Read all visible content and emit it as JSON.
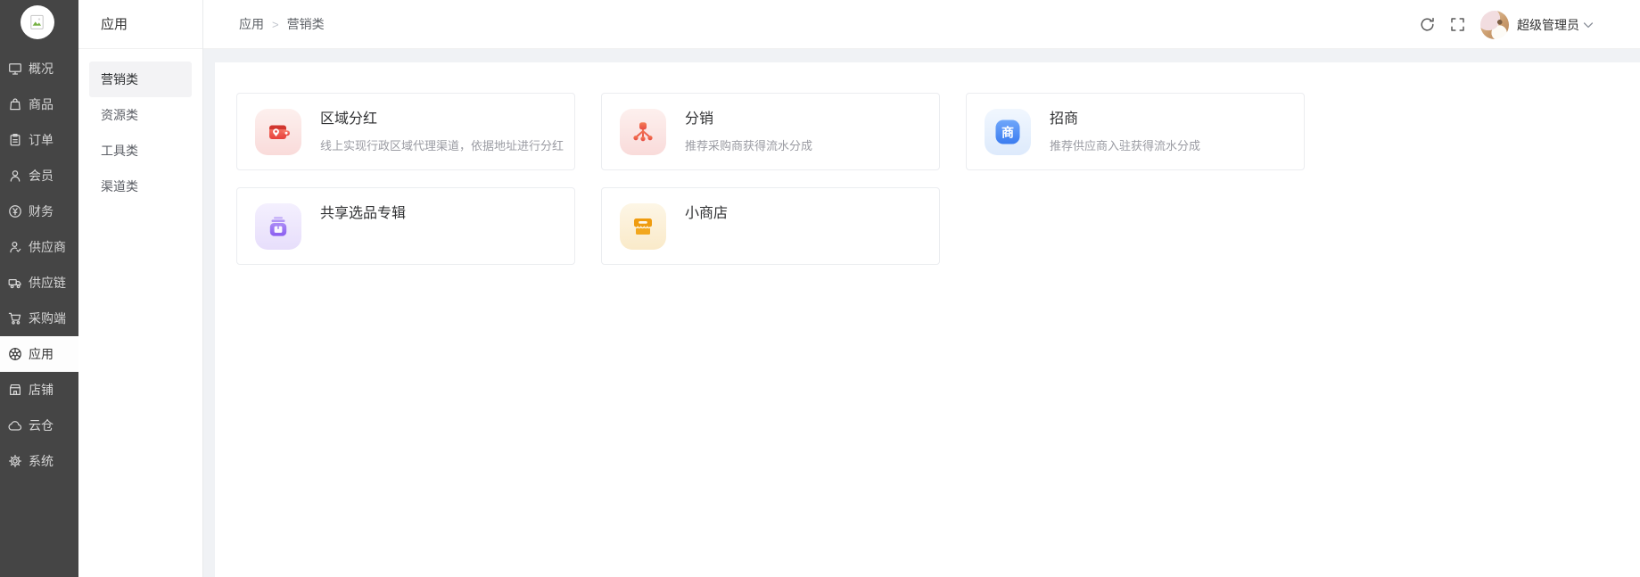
{
  "sidebar": {
    "items": [
      {
        "label": "概况"
      },
      {
        "label": "商品"
      },
      {
        "label": "订单"
      },
      {
        "label": "会员"
      },
      {
        "label": "财务"
      },
      {
        "label": "供应商"
      },
      {
        "label": "供应链"
      },
      {
        "label": "采购端"
      },
      {
        "label": "应用",
        "active": true
      },
      {
        "label": "店铺"
      },
      {
        "label": "云仓"
      },
      {
        "label": "系统"
      }
    ]
  },
  "submenu": {
    "title": "应用",
    "items": [
      {
        "label": "营销类",
        "active": true
      },
      {
        "label": "资源类"
      },
      {
        "label": "工具类"
      },
      {
        "label": "渠道类"
      }
    ]
  },
  "topbar": {
    "breadcrumb": [
      "应用",
      "营销类"
    ],
    "separator": ">",
    "icons": [
      "refresh-icon",
      "fullscreen-icon"
    ],
    "user_name": "超级管理员"
  },
  "cards": [
    {
      "title": "区域分红",
      "desc": "线上实现行政区域代理渠道，依据地址进行分红",
      "icon": "wallet-pin-icon",
      "theme": "red"
    },
    {
      "title": "分销",
      "desc": "推荐采购商获得流水分成",
      "icon": "network-tree-icon",
      "theme": "red"
    },
    {
      "title": "招商",
      "desc": "推荐供应商入驻获得流水分成",
      "icon": "merchant-badge-icon",
      "theme": "blue",
      "badge_char": "商"
    },
    {
      "title": "共享选品专辑",
      "desc": "",
      "icon": "album-box-icon",
      "theme": "purple"
    },
    {
      "title": "小商店",
      "desc": "",
      "icon": "storefront-icon",
      "theme": "orange"
    }
  ],
  "colors": {
    "sidebar_bg": "#454545",
    "content_bg": "#f0f2f5",
    "accent_red": "#e74c44",
    "accent_blue": "#3b7cf0",
    "accent_purple": "#8a5cf0",
    "accent_orange": "#ef9c0f"
  }
}
